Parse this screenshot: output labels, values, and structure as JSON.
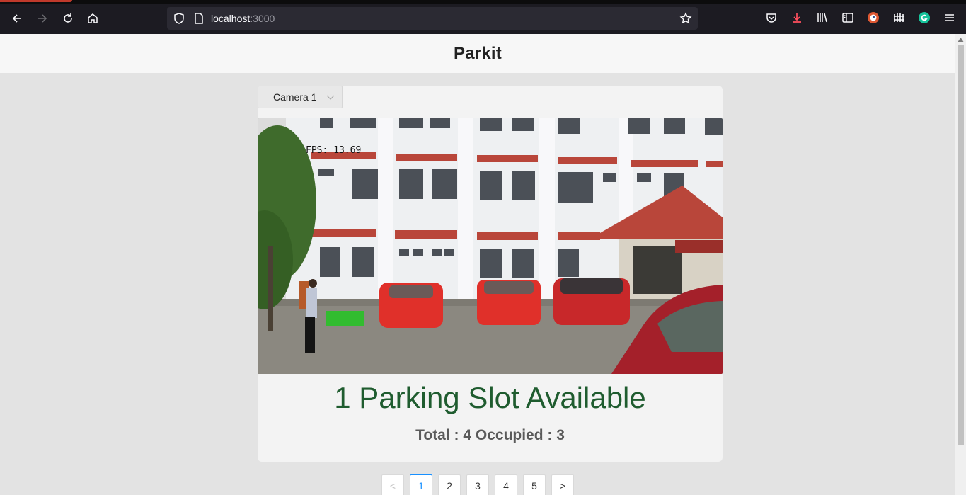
{
  "browser": {
    "url_host": "localhost",
    "url_port": ":3000"
  },
  "app": {
    "title": "Parkit"
  },
  "camera_select": {
    "selected": "Camera 1"
  },
  "video": {
    "overlay_text": "FPS: 13.69"
  },
  "status": {
    "headline": "1 Parking Slot Available",
    "counts": "Total : 4 Occupied : 3"
  },
  "pagination": {
    "prev": "<",
    "pages": [
      "1",
      "2",
      "3",
      "4",
      "5"
    ],
    "next": ">",
    "current": "1"
  },
  "colors": {
    "status_green": "#1f5c2f",
    "available_slot": "#22c522",
    "occupied_slot": "#e0302a",
    "pagination_active": "#1890ff"
  }
}
